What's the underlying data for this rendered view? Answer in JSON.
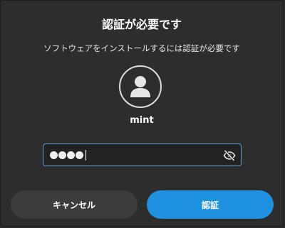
{
  "dialog": {
    "title": "認証が必要です",
    "message": "ソフトウェアをインストールするには認証が必要です"
  },
  "user": {
    "avatar_icon": "user-avatar-icon",
    "name": "mint"
  },
  "password": {
    "masked_length": 4,
    "reveal_icon": "eye-slash-icon"
  },
  "buttons": {
    "cancel_label": "キャンセル",
    "authenticate_label": "認証"
  },
  "colors": {
    "accent": "#1e92e1",
    "focus_border": "#5b9bd9",
    "background": "#2d2d2d"
  }
}
